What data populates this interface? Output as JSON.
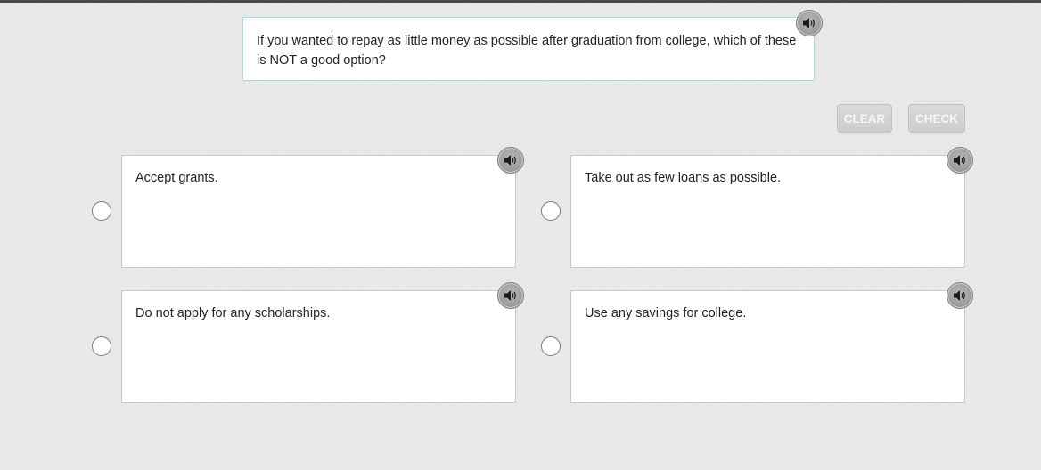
{
  "question": {
    "text": "If you wanted to repay as little money as possible after graduation from college, which of these is NOT a good option?",
    "audio_icon": "speaker-icon"
  },
  "actions": {
    "clear_label": "CLEAR",
    "check_label": "CHECK"
  },
  "options": [
    {
      "text": "Accept grants.",
      "selected": false
    },
    {
      "text": "Take out as few loans as possible.",
      "selected": false
    },
    {
      "text": "Do not apply for any scholarships.",
      "selected": false
    },
    {
      "text": "Use any savings for college.",
      "selected": false
    }
  ],
  "colors": {
    "background": "#e8e8e8",
    "question_border": "#a9d9e2",
    "button_disabled": "#d3d3d3"
  }
}
